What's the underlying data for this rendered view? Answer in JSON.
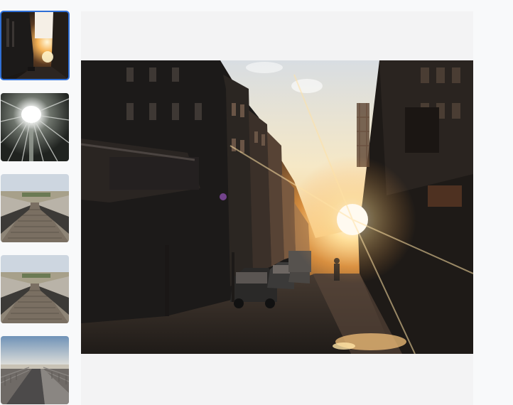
{
  "gallery": {
    "selected_index": 0,
    "thumbnails": [
      {
        "icon": "street-sunset-photo"
      },
      {
        "icon": "tunnel-light-photo"
      },
      {
        "icon": "boardwalk-bridge-photo"
      },
      {
        "icon": "boardwalk-bridge-photo"
      },
      {
        "icon": "pier-seaside-photo"
      }
    ],
    "main_image": {
      "icon": "street-sunset-photo"
    }
  },
  "colors": {
    "active_border": "#2f6fd6",
    "stage_background": "#f3f3f4",
    "page_background": "#f8f9fa"
  }
}
